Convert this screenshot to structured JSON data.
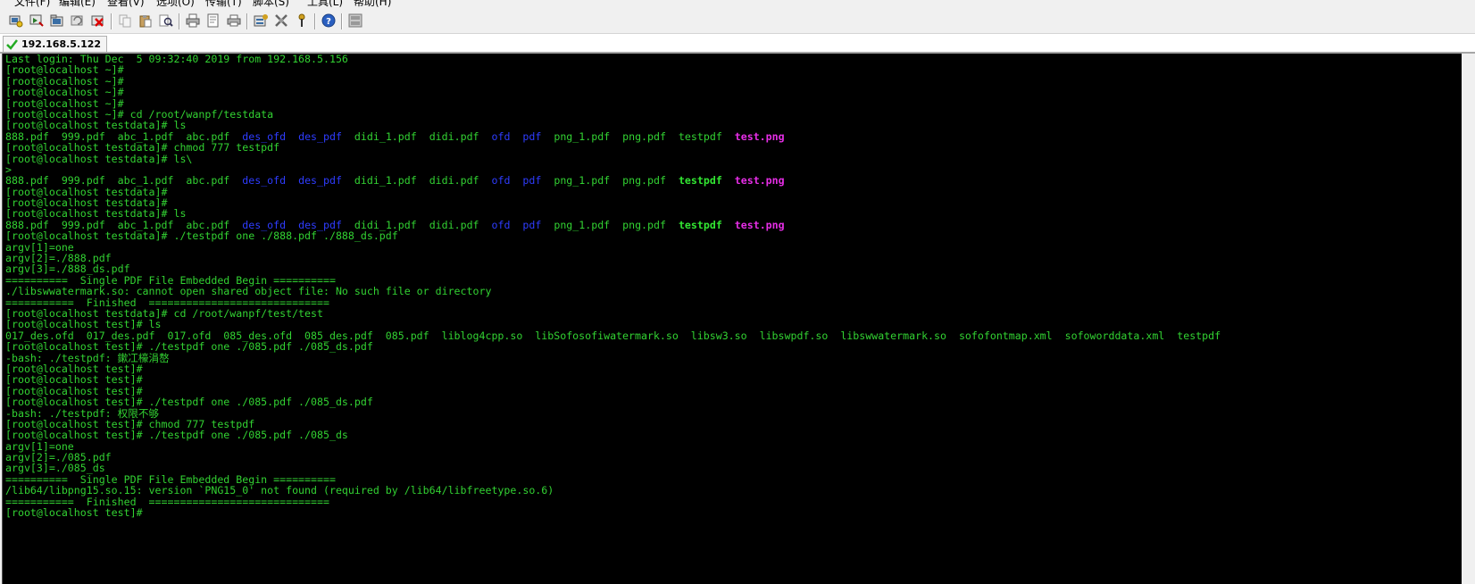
{
  "menu": [
    {
      "label": "文件(F)"
    },
    {
      "label": "编辑(E)"
    },
    {
      "label": "查看(V)"
    },
    {
      "label": "选项(O)"
    },
    {
      "label": "传输(T)"
    },
    {
      "label": "脚本(S)"
    },
    {
      "label": "工具(L)"
    },
    {
      "label": "帮助(H)"
    }
  ],
  "toolbar": {
    "icons": [
      "connect-icon",
      "quick-connect-icon",
      "connect-in-tab-icon",
      "reconnect-icon",
      "disconnect-icon",
      "copy-icon",
      "paste-icon",
      "find-icon",
      "print-icon",
      "print-setup-icon",
      "print-screen-icon",
      "session-options-icon",
      "global-options-icon",
      "keymap-icon",
      "help-icon",
      "sftp-icon"
    ]
  },
  "tab": {
    "title": "192.168.5.122",
    "status_color": "#22aa22"
  },
  "terminal": {
    "colors": {
      "text": "#32d232",
      "directory": "#2e3cff",
      "executable": "#32e632",
      "image": "#e62ee6",
      "background": "#000000"
    },
    "lines": [
      [
        {
          "t": "Last login: Thu Dec  5 09:32:40 2019 from 192.168.5.156"
        }
      ],
      [
        {
          "t": "[root@localhost ~]#"
        }
      ],
      [
        {
          "t": "[root@localhost ~]#"
        }
      ],
      [
        {
          "t": "[root@localhost ~]#"
        }
      ],
      [
        {
          "t": "[root@localhost ~]#"
        }
      ],
      [
        {
          "t": "[root@localhost ~]# cd /root/wanpf/testdata"
        }
      ],
      [
        {
          "t": "[root@localhost testdata]# ls"
        }
      ],
      [
        {
          "t": "888.pdf  999.pdf  abc_1.pdf  abc.pdf  "
        },
        {
          "t": "des_ofd",
          "c": "dir"
        },
        {
          "t": "  "
        },
        {
          "t": "des_pdf",
          "c": "dir"
        },
        {
          "t": "  didi_1.pdf  didi.pdf  "
        },
        {
          "t": "ofd",
          "c": "dir"
        },
        {
          "t": "  "
        },
        {
          "t": "pdf",
          "c": "dir"
        },
        {
          "t": "  png_1.pdf  png.pdf  testpdf  "
        },
        {
          "t": "test.png",
          "c": "img"
        }
      ],
      [
        {
          "t": "[root@localhost testdata]# chmod 777 testpdf"
        }
      ],
      [
        {
          "t": "[root@localhost testdata]# ls\\"
        }
      ],
      [
        {
          "t": ">"
        }
      ],
      [
        {
          "t": "888.pdf  999.pdf  abc_1.pdf  abc.pdf  "
        },
        {
          "t": "des_ofd",
          "c": "dir"
        },
        {
          "t": "  "
        },
        {
          "t": "des_pdf",
          "c": "dir"
        },
        {
          "t": "  didi_1.pdf  didi.pdf  "
        },
        {
          "t": "ofd",
          "c": "dir"
        },
        {
          "t": "  "
        },
        {
          "t": "pdf",
          "c": "dir"
        },
        {
          "t": "  png_1.pdf  png.pdf  "
        },
        {
          "t": "testpdf",
          "c": "exe"
        },
        {
          "t": "  "
        },
        {
          "t": "test.png",
          "c": "img"
        }
      ],
      [
        {
          "t": "[root@localhost testdata]#"
        }
      ],
      [
        {
          "t": "[root@localhost testdata]#"
        }
      ],
      [
        {
          "t": "[root@localhost testdata]# ls"
        }
      ],
      [
        {
          "t": "888.pdf  999.pdf  abc_1.pdf  abc.pdf  "
        },
        {
          "t": "des_ofd",
          "c": "dir"
        },
        {
          "t": "  "
        },
        {
          "t": "des_pdf",
          "c": "dir"
        },
        {
          "t": "  didi_1.pdf  didi.pdf  "
        },
        {
          "t": "ofd",
          "c": "dir"
        },
        {
          "t": "  "
        },
        {
          "t": "pdf",
          "c": "dir"
        },
        {
          "t": "  png_1.pdf  png.pdf  "
        },
        {
          "t": "testpdf",
          "c": "exe"
        },
        {
          "t": "  "
        },
        {
          "t": "test.png",
          "c": "img"
        }
      ],
      [
        {
          "t": "[root@localhost testdata]# ./testpdf one ./888.pdf ./888_ds.pdf"
        }
      ],
      [
        {
          "t": "argv[1]=one"
        }
      ],
      [
        {
          "t": "argv[2]=./888.pdf"
        }
      ],
      [
        {
          "t": "argv[3]=./888_ds.pdf"
        }
      ],
      [
        {
          "t": "==========  Single PDF File Embedded Begin =========="
        }
      ],
      [
        {
          "t": "./libswwatermark.so: cannot open shared object file: No such file or directory"
        }
      ],
      [
        {
          "t": "===========  Finished  ============================="
        }
      ],
      [
        {
          "t": "[root@localhost testdata]# cd /root/wanpf/test/test"
        }
      ],
      [
        {
          "t": "[root@localhost test]# ls"
        }
      ],
      [
        {
          "t": "017_des.ofd  017_des.pdf  017.ofd  085_des.ofd  085_des.pdf  085.pdf  liblog4cpp.so  libSofosofiwatermark.so  libsw3.so  libswpdf.so  libswwatermark.so  sofofontmap.xml  sofoworddata.xml  testpdf"
        }
      ],
      [
        {
          "t": "[root@localhost test]# ./testpdf one ./085.pdf ./085_ds.pdf"
        }
      ],
      [
        {
          "t": "-bash: ./testpdf: 鏉冮檺涓嶅"
        }
      ],
      [
        {
          "t": "[root@localhost test]#"
        }
      ],
      [
        {
          "t": "[root@localhost test]#"
        }
      ],
      [
        {
          "t": "[root@localhost test]#"
        }
      ],
      [
        {
          "t": "[root@localhost test]# ./testpdf one ./085.pdf ./085_ds.pdf"
        }
      ],
      [
        {
          "t": "-bash: ./testpdf: 权限不够"
        }
      ],
      [
        {
          "t": "[root@localhost test]# chmod 777 testpdf"
        }
      ],
      [
        {
          "t": "[root@localhost test]# ./testpdf one ./085.pdf ./085_ds"
        }
      ],
      [
        {
          "t": "argv[1]=one"
        }
      ],
      [
        {
          "t": "argv[2]=./085.pdf"
        }
      ],
      [
        {
          "t": "argv[3]=./085_ds"
        }
      ],
      [
        {
          "t": "==========  Single PDF File Embedded Begin =========="
        }
      ],
      [
        {
          "t": "/lib64/libpng15.so.15: version `PNG15_0' not found (required by /lib64/libfreetype.so.6)"
        }
      ],
      [
        {
          "t": "===========  Finished  ============================="
        }
      ],
      [
        {
          "t": "[root@localhost test]# "
        }
      ]
    ]
  }
}
